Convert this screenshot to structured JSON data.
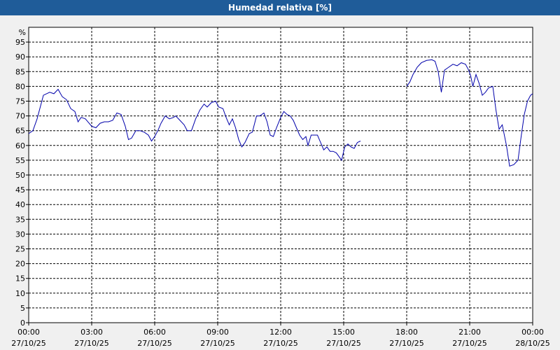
{
  "chart_data": {
    "type": "line",
    "title": "Humedad relativa [%]",
    "ylabel": "%",
    "ylim": [
      0,
      100
    ],
    "yticks": [
      0,
      5,
      10,
      15,
      20,
      25,
      30,
      35,
      40,
      45,
      50,
      55,
      60,
      65,
      70,
      75,
      80,
      85,
      90,
      95
    ],
    "xlim": [
      0,
      24
    ],
    "xticks": [
      {
        "x": 0,
        "time": "00:00",
        "date": "27/10/25"
      },
      {
        "x": 3,
        "time": "03:00",
        "date": "27/10/25"
      },
      {
        "x": 6,
        "time": "06:00",
        "date": "27/10/25"
      },
      {
        "x": 9,
        "time": "09:00",
        "date": "27/10/25"
      },
      {
        "x": 12,
        "time": "12:00",
        "date": "27/10/25"
      },
      {
        "x": 15,
        "time": "15:00",
        "date": "27/10/25"
      },
      {
        "x": 18,
        "time": "18:00",
        "date": "27/10/25"
      },
      {
        "x": 21,
        "time": "21:00",
        "date": "27/10/25"
      },
      {
        "x": 24,
        "time": "00:00",
        "date": "28/10/25"
      }
    ],
    "grid": true,
    "color": "#0000aa",
    "segments": [
      [
        [
          0,
          64
        ],
        [
          0.2,
          65
        ],
        [
          0.4,
          69
        ],
        [
          0.7,
          77
        ],
        [
          1.0,
          78
        ],
        [
          1.2,
          77.5
        ],
        [
          1.4,
          79
        ],
        [
          1.6,
          76.5
        ],
        [
          1.8,
          75.5
        ],
        [
          2.0,
          72.5
        ],
        [
          2.2,
          71.5
        ],
        [
          2.35,
          68
        ],
        [
          2.5,
          69.5
        ],
        [
          2.7,
          69
        ],
        [
          3.0,
          66.5
        ],
        [
          3.2,
          66
        ],
        [
          3.4,
          67.5
        ],
        [
          3.6,
          68
        ],
        [
          3.8,
          68
        ],
        [
          4.0,
          68.5
        ],
        [
          4.2,
          71
        ],
        [
          4.4,
          70.5
        ],
        [
          4.6,
          66.5
        ],
        [
          4.75,
          62
        ],
        [
          4.9,
          62.5
        ],
        [
          5.1,
          65
        ],
        [
          5.3,
          65
        ],
        [
          5.5,
          64.5
        ],
        [
          5.7,
          63.5
        ],
        [
          5.85,
          61.5
        ],
        [
          6.0,
          63
        ],
        [
          6.15,
          65
        ],
        [
          6.3,
          67.5
        ],
        [
          6.5,
          70
        ],
        [
          6.7,
          69
        ],
        [
          6.9,
          69.5
        ],
        [
          7.0,
          70
        ],
        [
          7.2,
          68.5
        ],
        [
          7.4,
          67
        ],
        [
          7.55,
          65
        ],
        [
          7.75,
          65
        ],
        [
          7.95,
          69
        ],
        [
          8.15,
          72
        ],
        [
          8.35,
          74
        ],
        [
          8.5,
          73
        ],
        [
          8.7,
          74.5
        ],
        [
          8.9,
          75
        ],
        [
          9.05,
          73
        ],
        [
          9.25,
          72.5
        ],
        [
          9.4,
          69.5
        ],
        [
          9.55,
          67
        ],
        [
          9.7,
          69
        ],
        [
          9.85,
          66
        ],
        [
          10.0,
          62
        ],
        [
          10.15,
          59.5
        ],
        [
          10.3,
          61
        ],
        [
          10.5,
          64
        ],
        [
          10.65,
          64.5
        ],
        [
          10.85,
          70
        ],
        [
          11.0,
          70
        ],
        [
          11.2,
          71
        ],
        [
          11.35,
          68
        ],
        [
          11.5,
          63.5
        ],
        [
          11.65,
          63
        ],
        [
          11.8,
          66
        ],
        [
          12.0,
          69.5
        ],
        [
          12.15,
          71.5
        ],
        [
          12.3,
          70.5
        ],
        [
          12.45,
          70
        ],
        [
          12.6,
          68.5
        ],
        [
          12.75,
          66
        ],
        [
          12.9,
          63.5
        ],
        [
          13.05,
          62
        ],
        [
          13.2,
          63
        ],
        [
          13.3,
          60
        ],
        [
          13.45,
          63.5
        ],
        [
          13.6,
          63.5
        ],
        [
          13.75,
          63.5
        ],
        [
          13.9,
          61
        ],
        [
          14.05,
          58.5
        ],
        [
          14.2,
          59.5
        ],
        [
          14.35,
          58
        ],
        [
          14.5,
          58
        ],
        [
          14.65,
          57.5
        ],
        [
          14.8,
          56
        ],
        [
          14.9,
          55
        ],
        [
          15.05,
          59.5
        ],
        [
          15.2,
          60.5
        ],
        [
          15.35,
          59.5
        ],
        [
          15.5,
          59
        ],
        [
          15.65,
          61
        ],
        [
          15.8,
          61.5
        ]
      ],
      [
        [
          18.0,
          80
        ],
        [
          18.15,
          81.5
        ],
        [
          18.3,
          84
        ],
        [
          18.5,
          86.5
        ],
        [
          18.7,
          88
        ],
        [
          18.95,
          88.8
        ],
        [
          19.2,
          89
        ],
        [
          19.35,
          88.5
        ],
        [
          19.5,
          85
        ],
        [
          19.65,
          78
        ],
        [
          19.8,
          85.5
        ],
        [
          20.0,
          86.5
        ],
        [
          20.2,
          87.5
        ],
        [
          20.4,
          87
        ],
        [
          20.6,
          88
        ],
        [
          20.8,
          87.5
        ],
        [
          20.95,
          85.5
        ],
        [
          21.05,
          83.5
        ],
        [
          21.15,
          80
        ],
        [
          21.3,
          84
        ],
        [
          21.45,
          81
        ],
        [
          21.6,
          77
        ],
        [
          21.75,
          78
        ],
        [
          21.9,
          79.5
        ],
        [
          22.1,
          80
        ],
        [
          22.25,
          72
        ],
        [
          22.4,
          65.5
        ],
        [
          22.55,
          67
        ],
        [
          22.75,
          60
        ],
        [
          22.9,
          53
        ],
        [
          23.1,
          53.5
        ],
        [
          23.3,
          55
        ],
        [
          23.45,
          63
        ],
        [
          23.6,
          70.5
        ],
        [
          23.75,
          75
        ],
        [
          23.9,
          77
        ],
        [
          24.0,
          77.5
        ]
      ]
    ]
  }
}
